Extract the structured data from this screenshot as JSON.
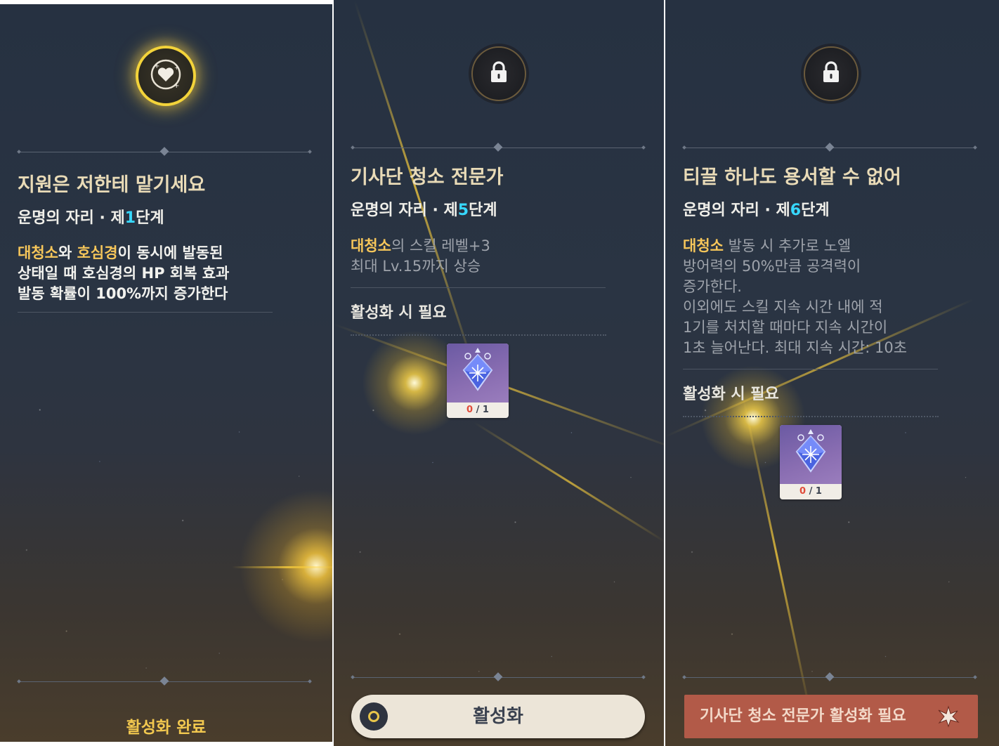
{
  "panels": [
    {
      "title": "지원은 저한테 맡기세요",
      "subtitle_prefix": "운명의 자리 · 제",
      "subtitle_num": "1",
      "subtitle_suffix": "단계",
      "desc_hl1": "대청소",
      "desc_t1": "와 ",
      "desc_hl2": "호심경",
      "desc_t2": "이 동시에 발동된",
      "desc_line2": "상태일 때 호심경의 HP 회복 효과",
      "desc_line3": "발동 확률이 100%까지 증가한다",
      "status_label": "활성화 완료",
      "emblem_icon": "heart-plus-icon"
    },
    {
      "title": "기사단 청소 전문가",
      "subtitle_prefix": "운명의 자리 · 제",
      "subtitle_num": "5",
      "subtitle_suffix": "단계",
      "desc_hl1": "대청소",
      "desc_t1": "의 스킬 레벨+3",
      "desc_line2": "최대 Lv.15까지 상승",
      "req_label": "활성화 시 필요",
      "item_have": "0",
      "item_sep": " / ",
      "item_need": "1",
      "button_label": "활성화",
      "emblem_icon": "lock-icon"
    },
    {
      "title": "티끌 하나도 용서할 수 없어",
      "subtitle_prefix": "운명의 자리 · 제",
      "subtitle_num": "6",
      "subtitle_suffix": "단계",
      "desc_hl1": "대청소",
      "desc_t1": " 발동 시 추가로 노엘",
      "desc_line2": "방어력의 50%만큼 공격력이",
      "desc_line3": "증가한다.",
      "desc_line4": "이외에도 스킬 지속 시간 내에 적",
      "desc_line5": "1기를 처치할 때마다 지속 시간이",
      "desc_line6": "1초 늘어난다. 최대 지속 시간: 10초",
      "req_label": "활성화 시 필요",
      "item_have": "0",
      "item_sep": " / ",
      "item_need": "1",
      "button_label": "기사단 청소 전문가 활성화 필요",
      "emblem_icon": "lock-icon"
    }
  ],
  "colors": {
    "highlight": "#f6c65a",
    "stage_number": "#37d8ff",
    "done": "#f2c84f",
    "need_button": "#b25a48",
    "activate_button": "#ece5d8"
  }
}
